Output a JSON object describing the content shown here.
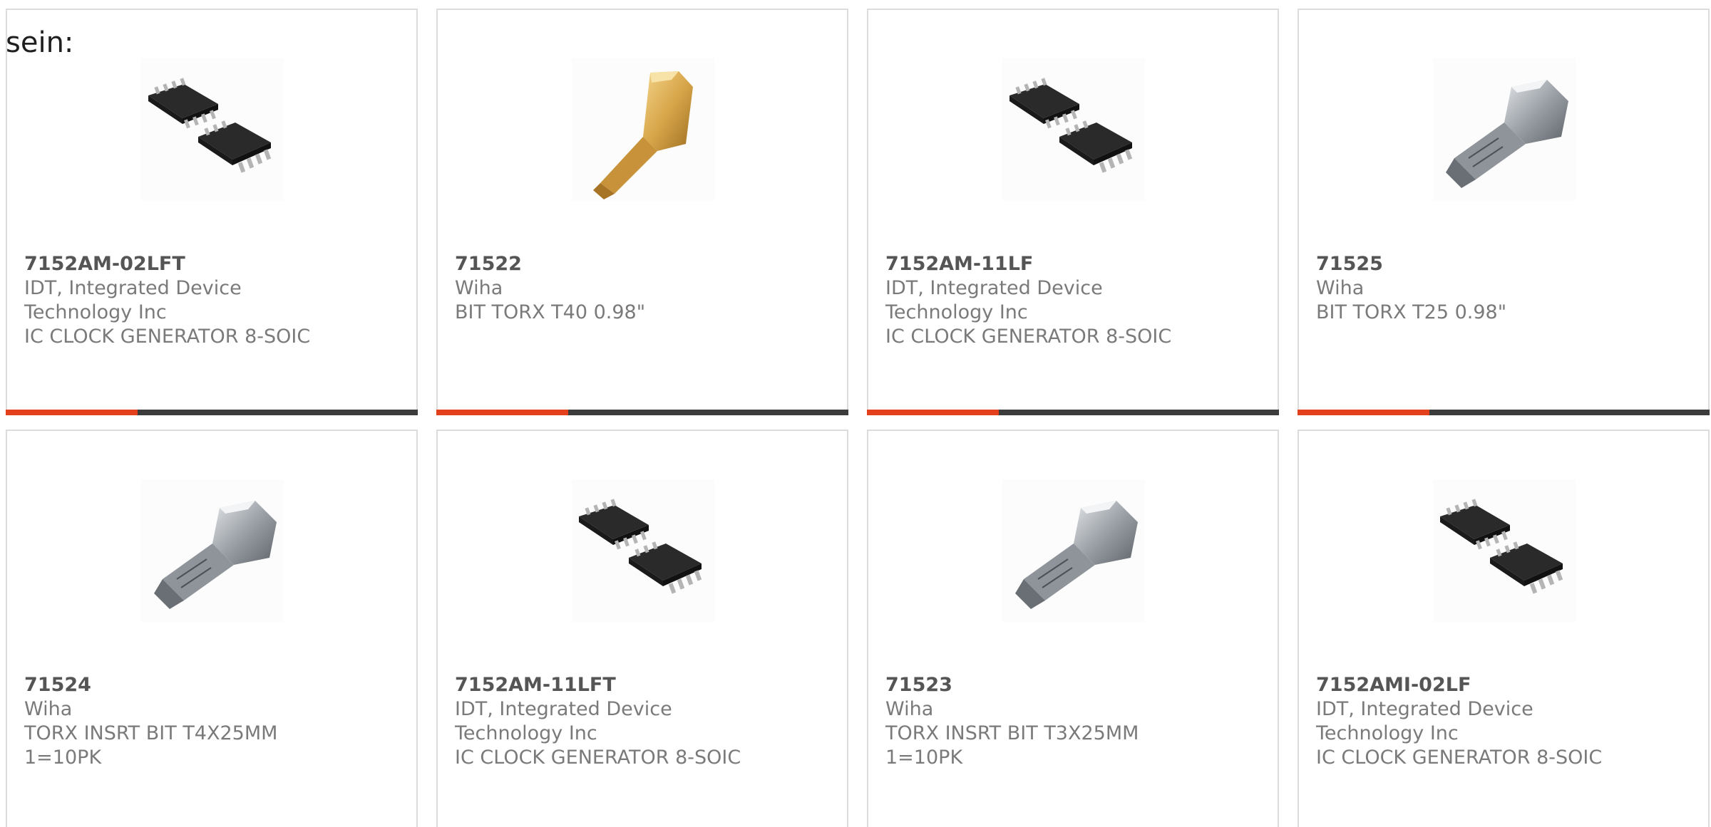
{
  "intro_text": "sein:",
  "colors": {
    "accent": "#e2411b",
    "bar_track": "#3c3c3c",
    "border": "#dcdcdc",
    "part_number": "#555555",
    "text": "#7a7a7a"
  },
  "products": [
    {
      "part_number": "7152AM-02LFT",
      "lines": [
        "IDT, Integrated Device",
        "Technology Inc",
        "IC CLOCK GENERATOR 8-SOIC"
      ],
      "image": "soic-8-chip-icon",
      "progress": 0.32
    },
    {
      "part_number": "71522",
      "lines": [
        "Wiha",
        "BIT TORX T40 0.98\""
      ],
      "image": "gold-torx-bit-icon",
      "progress": 0.32
    },
    {
      "part_number": "7152AM-11LF",
      "lines": [
        "IDT, Integrated Device",
        "Technology Inc",
        "IC CLOCK GENERATOR 8-SOIC"
      ],
      "image": "soic-8-chip-icon",
      "progress": 0.32
    },
    {
      "part_number": "71525",
      "lines": [
        "Wiha",
        "BIT TORX T25 0.98\""
      ],
      "image": "silver-torx-bit-icon",
      "progress": 0.32
    },
    {
      "part_number": "71524",
      "lines": [
        "Wiha",
        "TORX INSRT BIT T4X25MM",
        "1=10PK"
      ],
      "image": "silver-torx-bit-icon",
      "progress": null
    },
    {
      "part_number": "7152AM-11LFT",
      "lines": [
        "IDT, Integrated Device",
        "Technology Inc",
        "IC CLOCK GENERATOR 8-SOIC"
      ],
      "image": "soic-8-chip-icon",
      "progress": null
    },
    {
      "part_number": "71523",
      "lines": [
        "Wiha",
        "TORX INSRT BIT T3X25MM",
        "1=10PK"
      ],
      "image": "silver-torx-bit-icon",
      "progress": null
    },
    {
      "part_number": "7152AMI-02LF",
      "lines": [
        "IDT, Integrated Device",
        "Technology Inc",
        "IC CLOCK GENERATOR 8-SOIC"
      ],
      "image": "soic-8-chip-icon",
      "progress": null
    }
  ]
}
